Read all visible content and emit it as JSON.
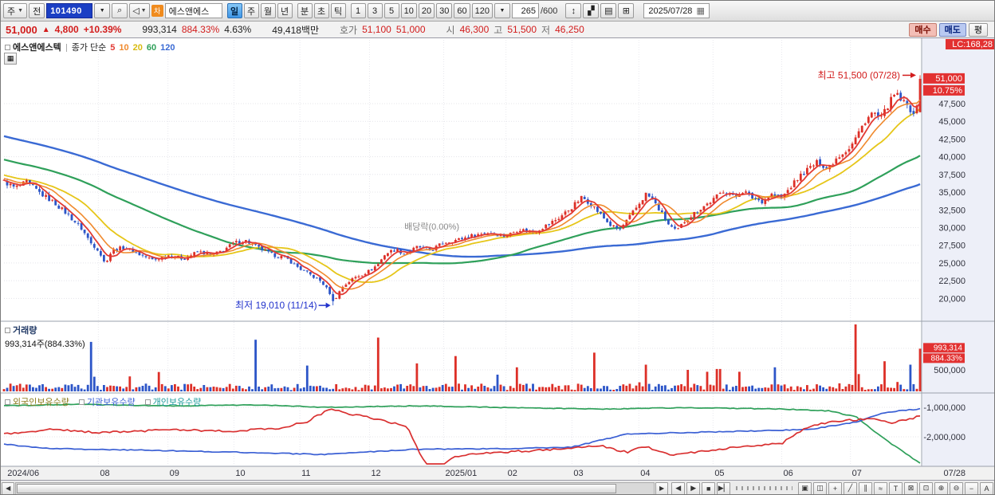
{
  "icons": {
    "dropdown": "▼",
    "search": "⌕",
    "speaker": "◁",
    "calendar": "▦",
    "grid": "▦"
  },
  "toolbar": {
    "period_combo": "주",
    "prev": "전",
    "code": "101490",
    "badge": "차",
    "stock_name": "에스앤에스",
    "periods": [
      {
        "label": "일",
        "active": true
      },
      {
        "label": "주",
        "active": false
      },
      {
        "label": "월",
        "active": false
      },
      {
        "label": "년",
        "active": false
      }
    ],
    "modes": [
      "분",
      "초",
      "틱"
    ],
    "intervals": [
      "1",
      "3",
      "5",
      "10",
      "20",
      "30",
      "60",
      "120"
    ],
    "count": "265",
    "count_total": "/600",
    "right_icons": [
      {
        "name": "scale-icon",
        "glyph": "↕"
      },
      {
        "name": "draw-icon",
        "glyph": "▞"
      },
      {
        "name": "chart-style-icon",
        "glyph": "▤"
      },
      {
        "name": "settings-icon",
        "glyph": "⊞"
      }
    ],
    "date": "2025/07/28"
  },
  "quote": {
    "price": "51,000",
    "arrow": "▲",
    "change": "4,800",
    "change_pct": "+10.39%",
    "volume": "993,314",
    "volume_ratio": "884.33%",
    "turnover_pct": "4.63%",
    "amount": "49,418백만",
    "hoga_label": "호가",
    "ask": "51,100",
    "bid": "51,000",
    "open_label": "시",
    "open": "46,300",
    "high_label": "고",
    "high": "51,500",
    "low_label": "저",
    "low": "46,250",
    "buy_button": "매수",
    "sell_button": "매도",
    "avg_button": "평"
  },
  "chart_header": {
    "stock_name": "에스앤에스텍",
    "legend": "종가 단순",
    "ma_labels": [
      {
        "label": "5",
        "color": "#e23b35"
      },
      {
        "label": "10",
        "color": "#f08a2e"
      },
      {
        "label": "20",
        "color": "#d8bb12"
      },
      {
        "label": "60",
        "color": "#2fa05a"
      },
      {
        "label": "120",
        "color": "#3a6ad4"
      }
    ]
  },
  "panels": {
    "volume_title": "거래량",
    "volume_value": "993,314주(884.33%)",
    "holdings": [
      {
        "name": "foreign-holdings-label",
        "label": "외국인보유수량",
        "color": "#8a7a1a"
      },
      {
        "name": "institution-holdings-label",
        "label": "기관보유수량",
        "color": "#3a5fd4"
      },
      {
        "name": "individual-holdings-label",
        "label": "개인보유수량",
        "color": "#1a9a9a"
      }
    ]
  },
  "annotations": {
    "high": "최고 51,500 (07/28)",
    "high_color": "#d21c1c",
    "low": "최저 19,010 (11/14)",
    "low_color": "#2233cc",
    "dividend": "배당락(0.00%)",
    "dividend_color": "#8a8a8a"
  },
  "axis": {
    "lc": "LC:168,28",
    "current": "51,000",
    "pct": "10.75%",
    "volume_box1": "993,314",
    "volume_box2": "884.33%",
    "volume_tick": "500,000",
    "date_label": "07/28"
  },
  "x_axis": {
    "ticks": [
      {
        "label": "2024/06",
        "f": 0.002
      },
      {
        "label": "08",
        "f": 0.103
      },
      {
        "label": "09",
        "f": 0.179
      },
      {
        "label": "10",
        "f": 0.251
      },
      {
        "label": "11",
        "f": 0.323
      },
      {
        "label": "12",
        "f": 0.399
      },
      {
        "label": "2025/01",
        "f": 0.48
      },
      {
        "label": "02",
        "f": 0.548
      },
      {
        "label": "03",
        "f": 0.62
      },
      {
        "label": "04",
        "f": 0.693
      },
      {
        "label": "05",
        "f": 0.774
      },
      {
        "label": "06",
        "f": 0.849
      },
      {
        "label": "07",
        "f": 0.924
      }
    ]
  },
  "bottom_bar": {
    "left_arrow": "◀",
    "right_arrow": "▶",
    "playback": [
      {
        "name": "rewind-button",
        "glyph": "◀"
      },
      {
        "name": "play-button",
        "glyph": "▶"
      },
      {
        "name": "stop-button",
        "glyph": "■"
      },
      {
        "name": "step-button",
        "glyph": "▶▏"
      }
    ],
    "tools": [
      {
        "name": "capture-icon",
        "glyph": "▣"
      },
      {
        "name": "windows-icon",
        "glyph": "◫"
      },
      {
        "name": "crosshair-icon",
        "glyph": "+"
      },
      {
        "name": "trendline-icon",
        "glyph": "╱"
      },
      {
        "name": "parallel-lines-icon",
        "glyph": "∥"
      },
      {
        "name": "wave-icon",
        "glyph": "≈"
      },
      {
        "name": "text-tool-icon",
        "glyph": "T"
      },
      {
        "name": "eraser-icon",
        "glyph": "⊠"
      },
      {
        "name": "zoom-area-icon",
        "glyph": "⊡"
      },
      {
        "name": "zoom-in-icon",
        "glyph": "⊕"
      },
      {
        "name": "zoom-out-icon",
        "glyph": "⊖"
      },
      {
        "name": "reset-zoom-icon",
        "glyph": "−"
      },
      {
        "name": "font-size-icon",
        "glyph": "A"
      }
    ]
  },
  "chart_data": {
    "type": "candlestick",
    "symbol": "에스앤에스텍",
    "code": "101490",
    "timeframe": "일",
    "price_axis": {
      "min": 17000,
      "max": 56500,
      "ticks": [
        47500,
        45000,
        42500,
        40000,
        37500,
        35000,
        32500,
        30000,
        27500,
        25000,
        22500,
        20000
      ]
    },
    "num_candles": 285,
    "pre_history": {
      "days": 120,
      "start_price": 49500
    },
    "close_anchors": [
      [
        0.0,
        36500
      ],
      [
        0.012,
        35600
      ],
      [
        0.025,
        36400
      ],
      [
        0.04,
        34800
      ],
      [
        0.055,
        33500
      ],
      [
        0.07,
        31800
      ],
      [
        0.085,
        29800
      ],
      [
        0.095,
        27800
      ],
      [
        0.103,
        26900
      ],
      [
        0.11,
        24900
      ],
      [
        0.118,
        26800
      ],
      [
        0.132,
        27200
      ],
      [
        0.148,
        26200
      ],
      [
        0.163,
        25400
      ],
      [
        0.179,
        26100
      ],
      [
        0.196,
        25600
      ],
      [
        0.212,
        26600
      ],
      [
        0.228,
        26100
      ],
      [
        0.24,
        26900
      ],
      [
        0.251,
        27800
      ],
      [
        0.263,
        28200
      ],
      [
        0.277,
        27200
      ],
      [
        0.292,
        26200
      ],
      [
        0.308,
        25700
      ],
      [
        0.323,
        24200
      ],
      [
        0.336,
        23200
      ],
      [
        0.347,
        22300
      ],
      [
        0.356,
        20700
      ],
      [
        0.36,
        19600
      ],
      [
        0.369,
        21600
      ],
      [
        0.382,
        22900
      ],
      [
        0.399,
        23900
      ],
      [
        0.409,
        24900
      ],
      [
        0.416,
        26300
      ],
      [
        0.427,
        26900
      ],
      [
        0.438,
        26300
      ],
      [
        0.452,
        27300
      ],
      [
        0.466,
        26800
      ],
      [
        0.48,
        27900
      ],
      [
        0.496,
        28300
      ],
      [
        0.512,
        28900
      ],
      [
        0.528,
        29300
      ],
      [
        0.548,
        28800
      ],
      [
        0.562,
        29800
      ],
      [
        0.577,
        29300
      ],
      [
        0.592,
        30300
      ],
      [
        0.606,
        31400
      ],
      [
        0.62,
        32900
      ],
      [
        0.631,
        34300
      ],
      [
        0.642,
        33200
      ],
      [
        0.652,
        31700
      ],
      [
        0.663,
        30200
      ],
      [
        0.672,
        29700
      ],
      [
        0.682,
        31300
      ],
      [
        0.693,
        33300
      ],
      [
        0.701,
        34800
      ],
      [
        0.709,
        33700
      ],
      [
        0.717,
        32200
      ],
      [
        0.726,
        30300
      ],
      [
        0.734,
        29400
      ],
      [
        0.743,
        30900
      ],
      [
        0.757,
        32400
      ],
      [
        0.774,
        33900
      ],
      [
        0.786,
        35300
      ],
      [
        0.797,
        34300
      ],
      [
        0.807,
        35200
      ],
      [
        0.817,
        34200
      ],
      [
        0.827,
        33700
      ],
      [
        0.838,
        34700
      ],
      [
        0.849,
        34200
      ],
      [
        0.859,
        35800
      ],
      [
        0.869,
        37300
      ],
      [
        0.879,
        38400
      ],
      [
        0.889,
        39300
      ],
      [
        0.899,
        38300
      ],
      [
        0.909,
        39900
      ],
      [
        0.924,
        41400
      ],
      [
        0.933,
        43400
      ],
      [
        0.941,
        45300
      ],
      [
        0.949,
        46300
      ],
      [
        0.957,
        45200
      ],
      [
        0.965,
        47300
      ],
      [
        0.973,
        48900
      ],
      [
        0.981,
        47800
      ],
      [
        0.989,
        46700
      ],
      [
        0.996,
        46200
      ],
      [
        1.0,
        51000
      ]
    ],
    "last_candle": {
      "open": 46300,
      "high": 51500,
      "low": 46250,
      "close": 51000
    },
    "low_point": {
      "f": 0.36,
      "low": 19010
    },
    "high_point": {
      "f": 1.0,
      "high": 51500
    },
    "ma": [
      {
        "period": 5,
        "color": "#e23b35",
        "width": 1.8
      },
      {
        "period": 10,
        "color": "#f08a2e",
        "width": 1.6
      },
      {
        "period": 20,
        "color": "#e6c619",
        "width": 1.8
      },
      {
        "period": 60,
        "color": "#2fa05a",
        "width": 2.2
      },
      {
        "period": 120,
        "color": "#3a6ad4",
        "width": 2.4
      }
    ],
    "volume": {
      "last": 993314,
      "axis_tick": 500000,
      "spikes": [
        [
          0.095,
          1150000,
          "d"
        ],
        [
          0.17,
          450000
        ],
        [
          0.275,
          1200000,
          "d"
        ],
        [
          0.33,
          600000
        ],
        [
          0.41,
          1250000,
          "u"
        ],
        [
          0.452,
          650000
        ],
        [
          0.493,
          820000,
          "u"
        ],
        [
          0.56,
          560000
        ],
        [
          0.645,
          900000,
          "u"
        ],
        [
          0.7,
          620000
        ],
        [
          0.745,
          500000
        ],
        [
          0.78,
          520000
        ],
        [
          0.843,
          560000
        ],
        [
          0.93,
          1650000,
          "u"
        ],
        [
          0.962,
          700000
        ],
        [
          0.988,
          620000
        ],
        [
          1,
          993314,
          "u"
        ]
      ]
    },
    "holdings": {
      "ticks": [
        -1000000,
        -2000000
      ],
      "series": [
        {
          "name": "foreign-holdings",
          "color": "#2fa05a",
          "jitter": 26000,
          "points": [
            [
              0,
              -950000
            ],
            [
              0.08,
              -900000
            ],
            [
              0.18,
              -950000
            ],
            [
              0.28,
              -920000
            ],
            [
              0.35,
              -1000000
            ],
            [
              0.45,
              -950000
            ],
            [
              0.55,
              -1010000
            ],
            [
              0.65,
              -1060000
            ],
            [
              0.75,
              -1010000
            ],
            [
              0.85,
              -1060000
            ],
            [
              0.9,
              -1120000
            ],
            [
              0.93,
              -1320000
            ],
            [
              0.96,
              -2050000
            ],
            [
              1,
              -2900000
            ]
          ]
        },
        {
          "name": "institution-holdings",
          "color": "#3a5fd4",
          "jitter": 30000,
          "points": [
            [
              0,
              -2250000
            ],
            [
              0.05,
              -2400000
            ],
            [
              0.15,
              -2450000
            ],
            [
              0.25,
              -2520000
            ],
            [
              0.35,
              -2600000
            ],
            [
              0.45,
              -2420000
            ],
            [
              0.55,
              -2400000
            ],
            [
              0.62,
              -2350000
            ],
            [
              0.66,
              -2050000
            ],
            [
              0.68,
              -1900000
            ],
            [
              0.75,
              -1850000
            ],
            [
              0.82,
              -1800000
            ],
            [
              0.88,
              -1750000
            ],
            [
              0.93,
              -1500000
            ],
            [
              0.96,
              -1180000
            ],
            [
              1,
              -1050000
            ]
          ]
        },
        {
          "name": "individual-holdings",
          "color": "#d93030",
          "jitter": 70000,
          "points": [
            [
              0,
              -1900000
            ],
            [
              0.05,
              -1750000
            ],
            [
              0.1,
              -1850000
            ],
            [
              0.15,
              -1800000
            ],
            [
              0.2,
              -1760000
            ],
            [
              0.25,
              -1820000
            ],
            [
              0.3,
              -1700000
            ],
            [
              0.33,
              -1500000
            ],
            [
              0.355,
              -1060000
            ],
            [
              0.375,
              -1200000
            ],
            [
              0.4,
              -1350000
            ],
            [
              0.44,
              -1650000
            ],
            [
              0.465,
              -3250000
            ],
            [
              0.49,
              -2700000
            ],
            [
              0.52,
              -2550000
            ],
            [
              0.57,
              -2480000
            ],
            [
              0.62,
              -2380000
            ],
            [
              0.65,
              -2300000
            ],
            [
              0.68,
              -2520000
            ],
            [
              0.7,
              -2320000
            ],
            [
              0.73,
              -2620000
            ],
            [
              0.78,
              -2420000
            ],
            [
              0.82,
              -2300000
            ],
            [
              0.85,
              -2200000
            ],
            [
              0.88,
              -1620000
            ],
            [
              0.9,
              -1500000
            ],
            [
              0.93,
              -1420000
            ],
            [
              0.95,
              -1360000
            ],
            [
              0.97,
              -1520000
            ],
            [
              1,
              -1300000
            ]
          ]
        }
      ]
    }
  }
}
